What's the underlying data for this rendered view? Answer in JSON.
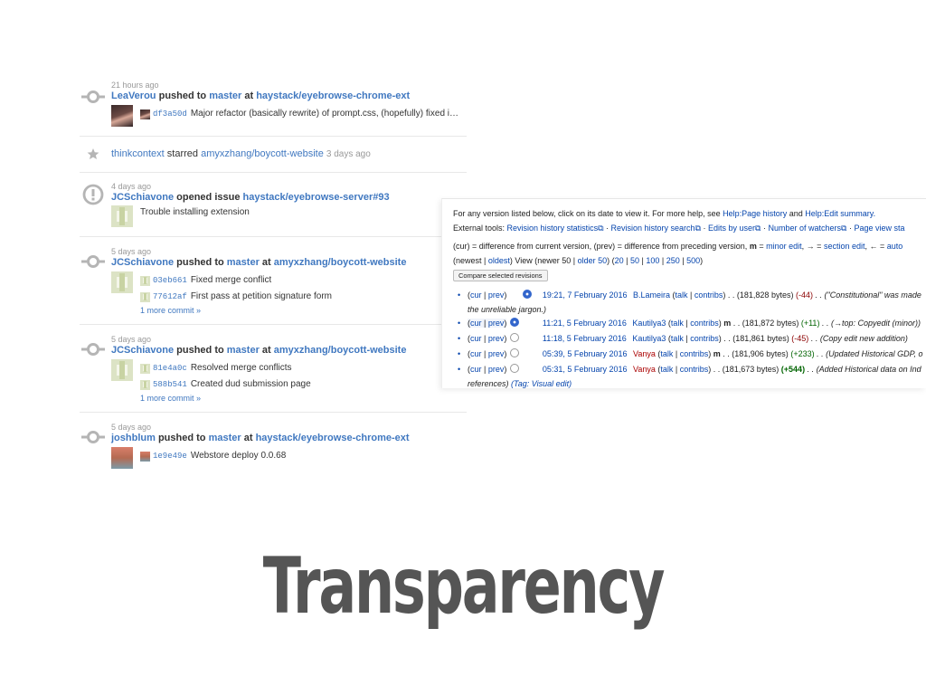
{
  "slide_title": "Transparency",
  "feed": {
    "e1": {
      "time": "21 hours ago",
      "user": "LeaVerou",
      "action": "pushed to",
      "branch": "master",
      "at": "at",
      "repo": "haystack/eyebrowse-chrome-ext",
      "commits": [
        {
          "sha": "df3a50d",
          "msg": "Major refactor (basically rewrite) of prompt.css, (hopefully) fixed i…"
        }
      ]
    },
    "e2": {
      "user": "thinkcontext",
      "action": "starred",
      "repo": "amyxzhang/boycott-website",
      "time": "3 days ago"
    },
    "e3": {
      "time": "4 days ago",
      "user": "JCSchiavone",
      "action": "opened issue",
      "issue": "haystack/eyebrowse-server#93",
      "text": "Trouble installing extension"
    },
    "e4": {
      "time": "5 days ago",
      "user": "JCSchiavone",
      "action": "pushed to",
      "branch": "master",
      "at": "at",
      "repo": "amyxzhang/boycott-website",
      "commits": [
        {
          "sha": "03eb661",
          "msg": "Fixed merge conflict"
        },
        {
          "sha": "77612af",
          "msg": "First pass at petition signature form"
        }
      ],
      "more": "1 more commit »"
    },
    "e5": {
      "time": "5 days ago",
      "user": "JCSchiavone",
      "action": "pushed to",
      "branch": "master",
      "at": "at",
      "repo": "amyxzhang/boycott-website",
      "commits": [
        {
          "sha": "81e4a0c",
          "msg": "Resolved merge conflicts"
        },
        {
          "sha": "588b541",
          "msg": "Created dud submission page"
        }
      ],
      "more": "1 more commit »"
    },
    "e6": {
      "time": "5 days ago",
      "user": "joshblum",
      "action": "pushed to",
      "branch": "master",
      "at": "at",
      "repo": "haystack/eyebrowse-chrome-ext",
      "commits": [
        {
          "sha": "1e9e49e",
          "msg": "Webstore deploy 0.0.68"
        }
      ]
    }
  },
  "wiki": {
    "intro_text": "For any version listed below, click on its date to view it. For more help, see",
    "help_history": "Help:Page history",
    "and": "and",
    "help_edit": "Help:Edit summary.",
    "external_tools": "External tools:",
    "tool1": "Revision history statistics",
    "tool2": "Revision history search",
    "tool3": "Edits by user",
    "tool4": "Number of watchers",
    "tool5": "Page view sta",
    "legend_a": "(cur) = difference from current version, (prev) = difference from preceding version,",
    "legend_m": "m",
    "legend_eq": "=",
    "legend_minor": "minor edit",
    "legend_arrow1": ", → =",
    "legend_section": "section edit",
    "legend_arrow2": ", ← =",
    "legend_auto": "auto",
    "nav_newest": "(newest |",
    "nav_oldest": "oldest",
    "nav_view": ") View (newer 50 |",
    "nav_older": "older 50",
    "nav_rest": ") (",
    "nav_20": "20",
    "nav_50": "50",
    "nav_100": "100",
    "nav_250": "250",
    "nav_500": "500",
    "nav_close": ")",
    "compare_button": "Compare selected revisions",
    "revs": [
      {
        "cur": "cur",
        "prev": "prev",
        "date": "19:21, 7 February 2016",
        "user": "B.Lameira",
        "talk": "talk",
        "contribs": "contribs",
        "minor": "",
        "bytes": ". . (181,828 bytes)",
        "diff": "(-44)",
        "diff_kind": "minus",
        "comment": ". . (\"Constitutional\" was made",
        "cont": "the unreliable jargon.)"
      },
      {
        "cur": "cur",
        "prev": "prev",
        "date": "11:21, 5 February 2016",
        "user": "Kautilya3",
        "talk": "talk",
        "contribs": "contribs",
        "minor": "m",
        "bytes": ". . (181,872 bytes)",
        "diff": "(+11)",
        "diff_kind": "plus",
        "comment": ". . (→top: Copyedit (minor))"
      },
      {
        "cur": "cur",
        "prev": "prev",
        "date": "11:18, 5 February 2016",
        "user": "Kautilya3",
        "talk": "talk",
        "contribs": "contribs",
        "minor": "",
        "bytes": ". . (181,861 bytes)",
        "diff": "(-45)",
        "diff_kind": "minus",
        "comment": ". . (Copy edit new addition)"
      },
      {
        "cur": "cur",
        "prev": "prev",
        "date": "05:39, 5 February 2016",
        "user": "Vanya",
        "talk": "talk",
        "contribs": "contribs",
        "minor": "m",
        "bytes": ". . (181,906 bytes)",
        "diff": "(+233)",
        "diff_kind": "plus",
        "comment": ". . (Updated Historical GDP, o"
      },
      {
        "cur": "cur",
        "prev": "prev",
        "date": "05:31, 5 February 2016",
        "user": "Vanya",
        "talk": "talk",
        "contribs": "contribs",
        "minor": "",
        "bytes": ". . (181,673 bytes)",
        "diff": "(+544)",
        "diff_kind": "plusbig",
        "comment": ". . (Added Historical data on Ind",
        "cont": "references)",
        "tag": "(Tag: Visual edit)"
      }
    ]
  }
}
